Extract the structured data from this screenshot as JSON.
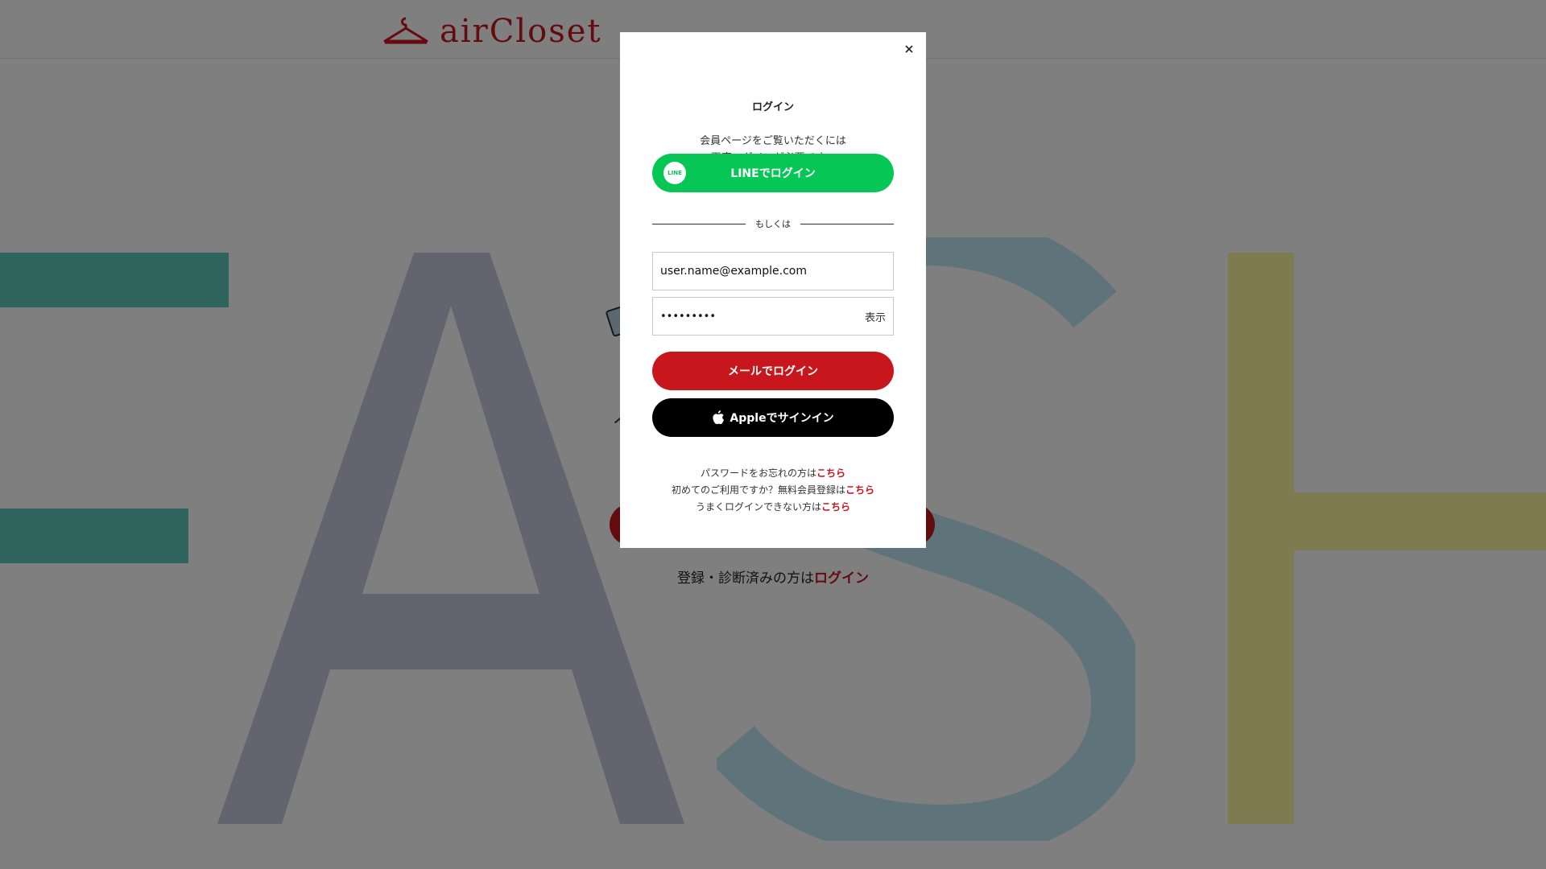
{
  "background": {
    "logo_text": "airCloset",
    "big_letters": [
      "F",
      "A",
      "S",
      "H"
    ],
    "login_prompt": "登録・診断済みの方は",
    "login_link": "ログイン"
  },
  "modal": {
    "title": "ログイン",
    "description_line1": "会員ページをご覧いただくには",
    "description_line2": "再度ログインが必要です。",
    "line_badge": "LINE",
    "line_button": "LINEでログイン",
    "divider_text": "もしくは",
    "email_value": "user.name@example.com",
    "password_value": "•••••••••",
    "show_password": "表示",
    "mail_login_button": "メールでログイン",
    "apple_signin_button": "Appleでサインイン",
    "forgot_password_prefix": "パスワードをお忘れの方は",
    "forgot_password_link": "こちら",
    "signup_prefix": "初めてのご利用ですか？無料会員登録は",
    "signup_link": "こちら",
    "trouble_prefix": "うまくログインできない方は",
    "trouble_link": "こちら"
  },
  "colors": {
    "brand_red": "#c8161d",
    "line_green": "#06c755",
    "apple_black": "#000000",
    "bg_teal": "#5fc7bb",
    "bg_navy": "#c7c9e1",
    "bg_blue": "#bfe6f5",
    "bg_yellow": "#fff7a3"
  },
  "icons": {
    "close": "close-icon",
    "line": "line-icon",
    "apple": "apple-icon",
    "hanger": "hanger-logo-icon"
  }
}
